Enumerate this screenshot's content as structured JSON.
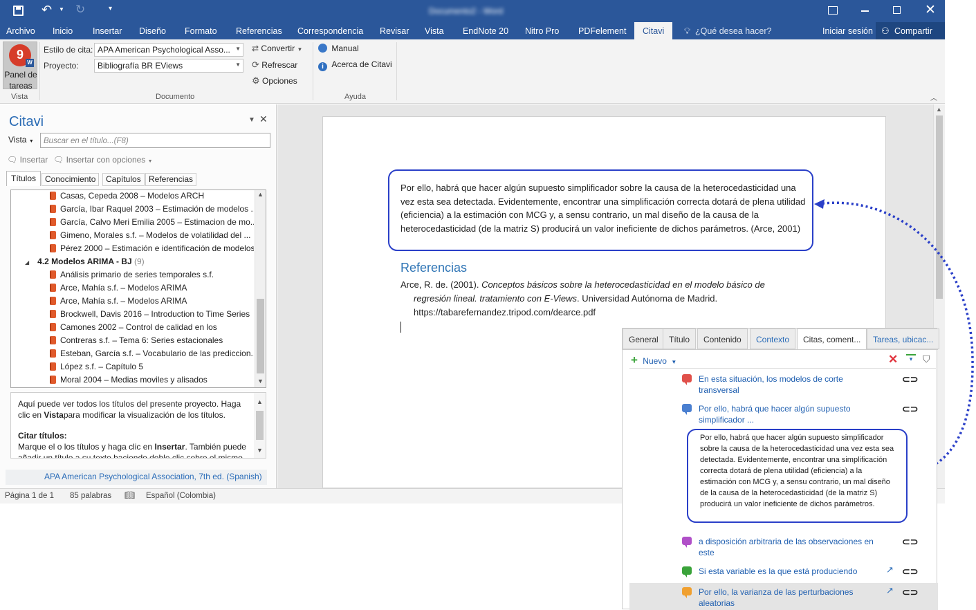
{
  "titlebar": {
    "title": "Documento2 - Word",
    "save_icon": "save-icon",
    "undo_icon": "undo-icon",
    "redo_icon": "redo-icon",
    "ribbon_display_icon": "ribbon-display-options-icon"
  },
  "ribbon_tabs": [
    "Archivo",
    "Inicio",
    "Insertar",
    "Diseño",
    "Formato",
    "Referencias",
    "Correspondencia",
    "Revisar",
    "Vista",
    "EndNote 20",
    "Nitro Pro",
    "PDFelement",
    "Citavi"
  ],
  "tell_me": "¿Qué desea hacer?",
  "signin": "Iniciar sesión",
  "share": "Compartir",
  "ribbon": {
    "panel_button_line1": "Panel de",
    "panel_button_line2": "tareas",
    "group_vista": "Vista",
    "estilo_label": "Estilo de cita:",
    "estilo_value": "APA American Psychological Asso...",
    "proyecto_label": "Proyecto:",
    "proyecto_value": "Bibliografía BR EViews",
    "convertir": "Convertir",
    "refrescar": "Refrescar",
    "opciones": "Opciones",
    "group_documento": "Documento",
    "manual": "Manual",
    "acerca": "Acerca de Citavi",
    "group_ayuda": "Ayuda"
  },
  "panel": {
    "title": "Citavi",
    "vista": "Vista",
    "search_placeholder": "Buscar en el título...(F8)",
    "insertar": "Insertar",
    "insertar_opciones": "Insertar con opciones",
    "tabs": [
      "Títulos",
      "Conocimiento",
      "Capítulos",
      "Referencias"
    ],
    "tree": [
      {
        "text": "Casas, Cepeda 2008 – Modelos ARCH",
        "type": "book"
      },
      {
        "text": "García, Ibar Raquel 2003 – Estimación de modelos ...",
        "type": "book"
      },
      {
        "text": "García, Calvo Meri Emilia 2005 – Estimacion de mo...",
        "type": "book"
      },
      {
        "text": "Gimeno, Morales s.f. – Modelos de volatilidad del ...",
        "type": "book"
      },
      {
        "text": "Pérez 2000 – Estimación e identificación de modelos",
        "type": "book"
      },
      {
        "text": "4.2 Modelos ARIMA - BJ",
        "type": "group",
        "count": "(9)"
      },
      {
        "text": "Análisis primario de series temporales s.f.",
        "type": "book"
      },
      {
        "text": "Arce, Mahía s.f. – Modelos ARIMA",
        "type": "book"
      },
      {
        "text": "Arce, Mahía s.f. – Modelos ARIMA",
        "type": "book"
      },
      {
        "text": "Brockwell, Davis 2016 – Introduction to Time Series",
        "type": "book"
      },
      {
        "text": "Camones 2002 – Control de calidad en los",
        "type": "book"
      },
      {
        "text": "Contreras s.f. – Tema 6: Series estacionales",
        "type": "book"
      },
      {
        "text": "Esteban, García s.f. – Vocabulario de las prediccion...",
        "type": "book"
      },
      {
        "text": "López s.f. – Capítulo 5",
        "type": "book"
      },
      {
        "text": "Moral 2004 – Medias moviles y alisados",
        "type": "book"
      }
    ],
    "help_p1a": "Aquí puede ver todos los títulos del presente proyecto. Haga clic en ",
    "help_p1b": "Vista",
    "help_p1c": "para modificar la visualización de los títulos.",
    "help_h2": "Citar títulos:",
    "help_p2a": "Marque el o los títulos y haga clic en ",
    "help_p2b": "Insertar",
    "help_p2c": ". También puede añadir un título a su texto haciendo doble clic sobre el mismo.",
    "footer_style": "APA American Psychological Association, 7th ed. (Spanish)"
  },
  "document": {
    "quote": "Por ello, habrá que hacer algún supuesto simplificador sobre la causa de la heterocedasticidad una vez esta sea detectada. Evidentemente, encontrar una simplificación correcta dotará de plena utilidad (eficiencia) a la estimación con MCG y, a sensu contrario, un mal diseño de la causa de la heterocedasticidad (de la matriz S) producirá un valor ineficiente de dichos parámetros. (Arce, 2001)",
    "refs_heading": "Referencias",
    "ref_author": "Arce, R. de. (2001). ",
    "ref_title": "Conceptos básicos sobre la heterocedasticidad en el modelo básico de regresión lineal. tratamiento con E-Views",
    "ref_rest": ". Universidad Autónoma de Madrid.",
    "ref_url": "https://tabarefernandez.tripod.com/dearce.pdf"
  },
  "popup": {
    "tabs": [
      "General",
      "Título",
      "Contenido",
      "Contexto",
      "Citas, coment...",
      "Tareas, ubicac..."
    ],
    "nuevo": "Nuevo",
    "items": [
      {
        "text": "En esta situación, los modelos de corte transversal",
        "color": "#e0504a"
      },
      {
        "text": "Por ello, habrá que hacer algún supuesto simplificador ...",
        "color": "#4a7fd0"
      },
      {
        "text": "a disposición arbitraria de las observaciones en este",
        "color": "#b04fc8"
      },
      {
        "text": "Si esta variable es la que está produciendo",
        "color": "#3aa33a"
      },
      {
        "text": "Por ello, la varianza de las perturbaciones aleatorias",
        "color": "#f0a030"
      }
    ],
    "expanded": "Por ello, habrá que hacer algún supuesto simplificador sobre la causa de la heterocedasticidad una vez esta sea detectada. Evidentemente, encontrar una simplificación correcta dotará de plena utilidad (eficiencia) a la estimación con MCG y, a sensu contrario, un mal diseño de la causa de la heterocedasticidad (de la matriz S) producirá un valor ineficiente de dichos parámetros."
  },
  "status": {
    "page": "Página 1 de 1",
    "words": "85 palabras",
    "language": "Español (Colombia)"
  },
  "colors": {
    "word_blue": "#2b579a",
    "callout_blue": "#2a3fc8",
    "citavi_blue": "#2a6cb8"
  }
}
